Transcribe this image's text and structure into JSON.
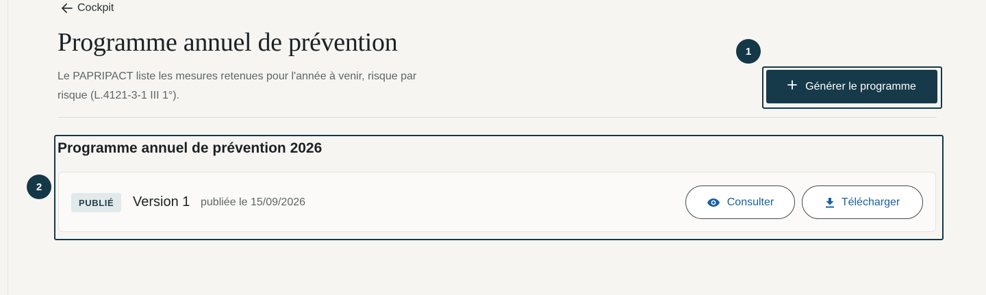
{
  "nav": {
    "back_label": "Cockpit",
    "back_icon": "arrow-left-icon"
  },
  "header": {
    "title": "Programme annuel de prévention",
    "description": "Le PAPRIPACT liste les mesures retenues pour l'année à venir, risque par risque (L.4121-3-1 III 1°)."
  },
  "annotations": {
    "marker_1": "1",
    "marker_2": "2"
  },
  "actions": {
    "generate_label": "Générer le programme",
    "generate_icon": "plus-icon"
  },
  "program": {
    "title": "Programme annuel de prévention 2026",
    "version": {
      "status": "PUBLIÉ",
      "label": "Version 1",
      "published": "publiée le 15/09/2026",
      "view_label": "Consulter",
      "view_icon": "eye-icon",
      "download_label": "Télécharger",
      "download_icon": "download-icon"
    }
  },
  "colors": {
    "primary": "#163a49",
    "link": "#1a5fa3",
    "background": "#f6f5f2",
    "badge_bg": "#e2e9eb"
  }
}
